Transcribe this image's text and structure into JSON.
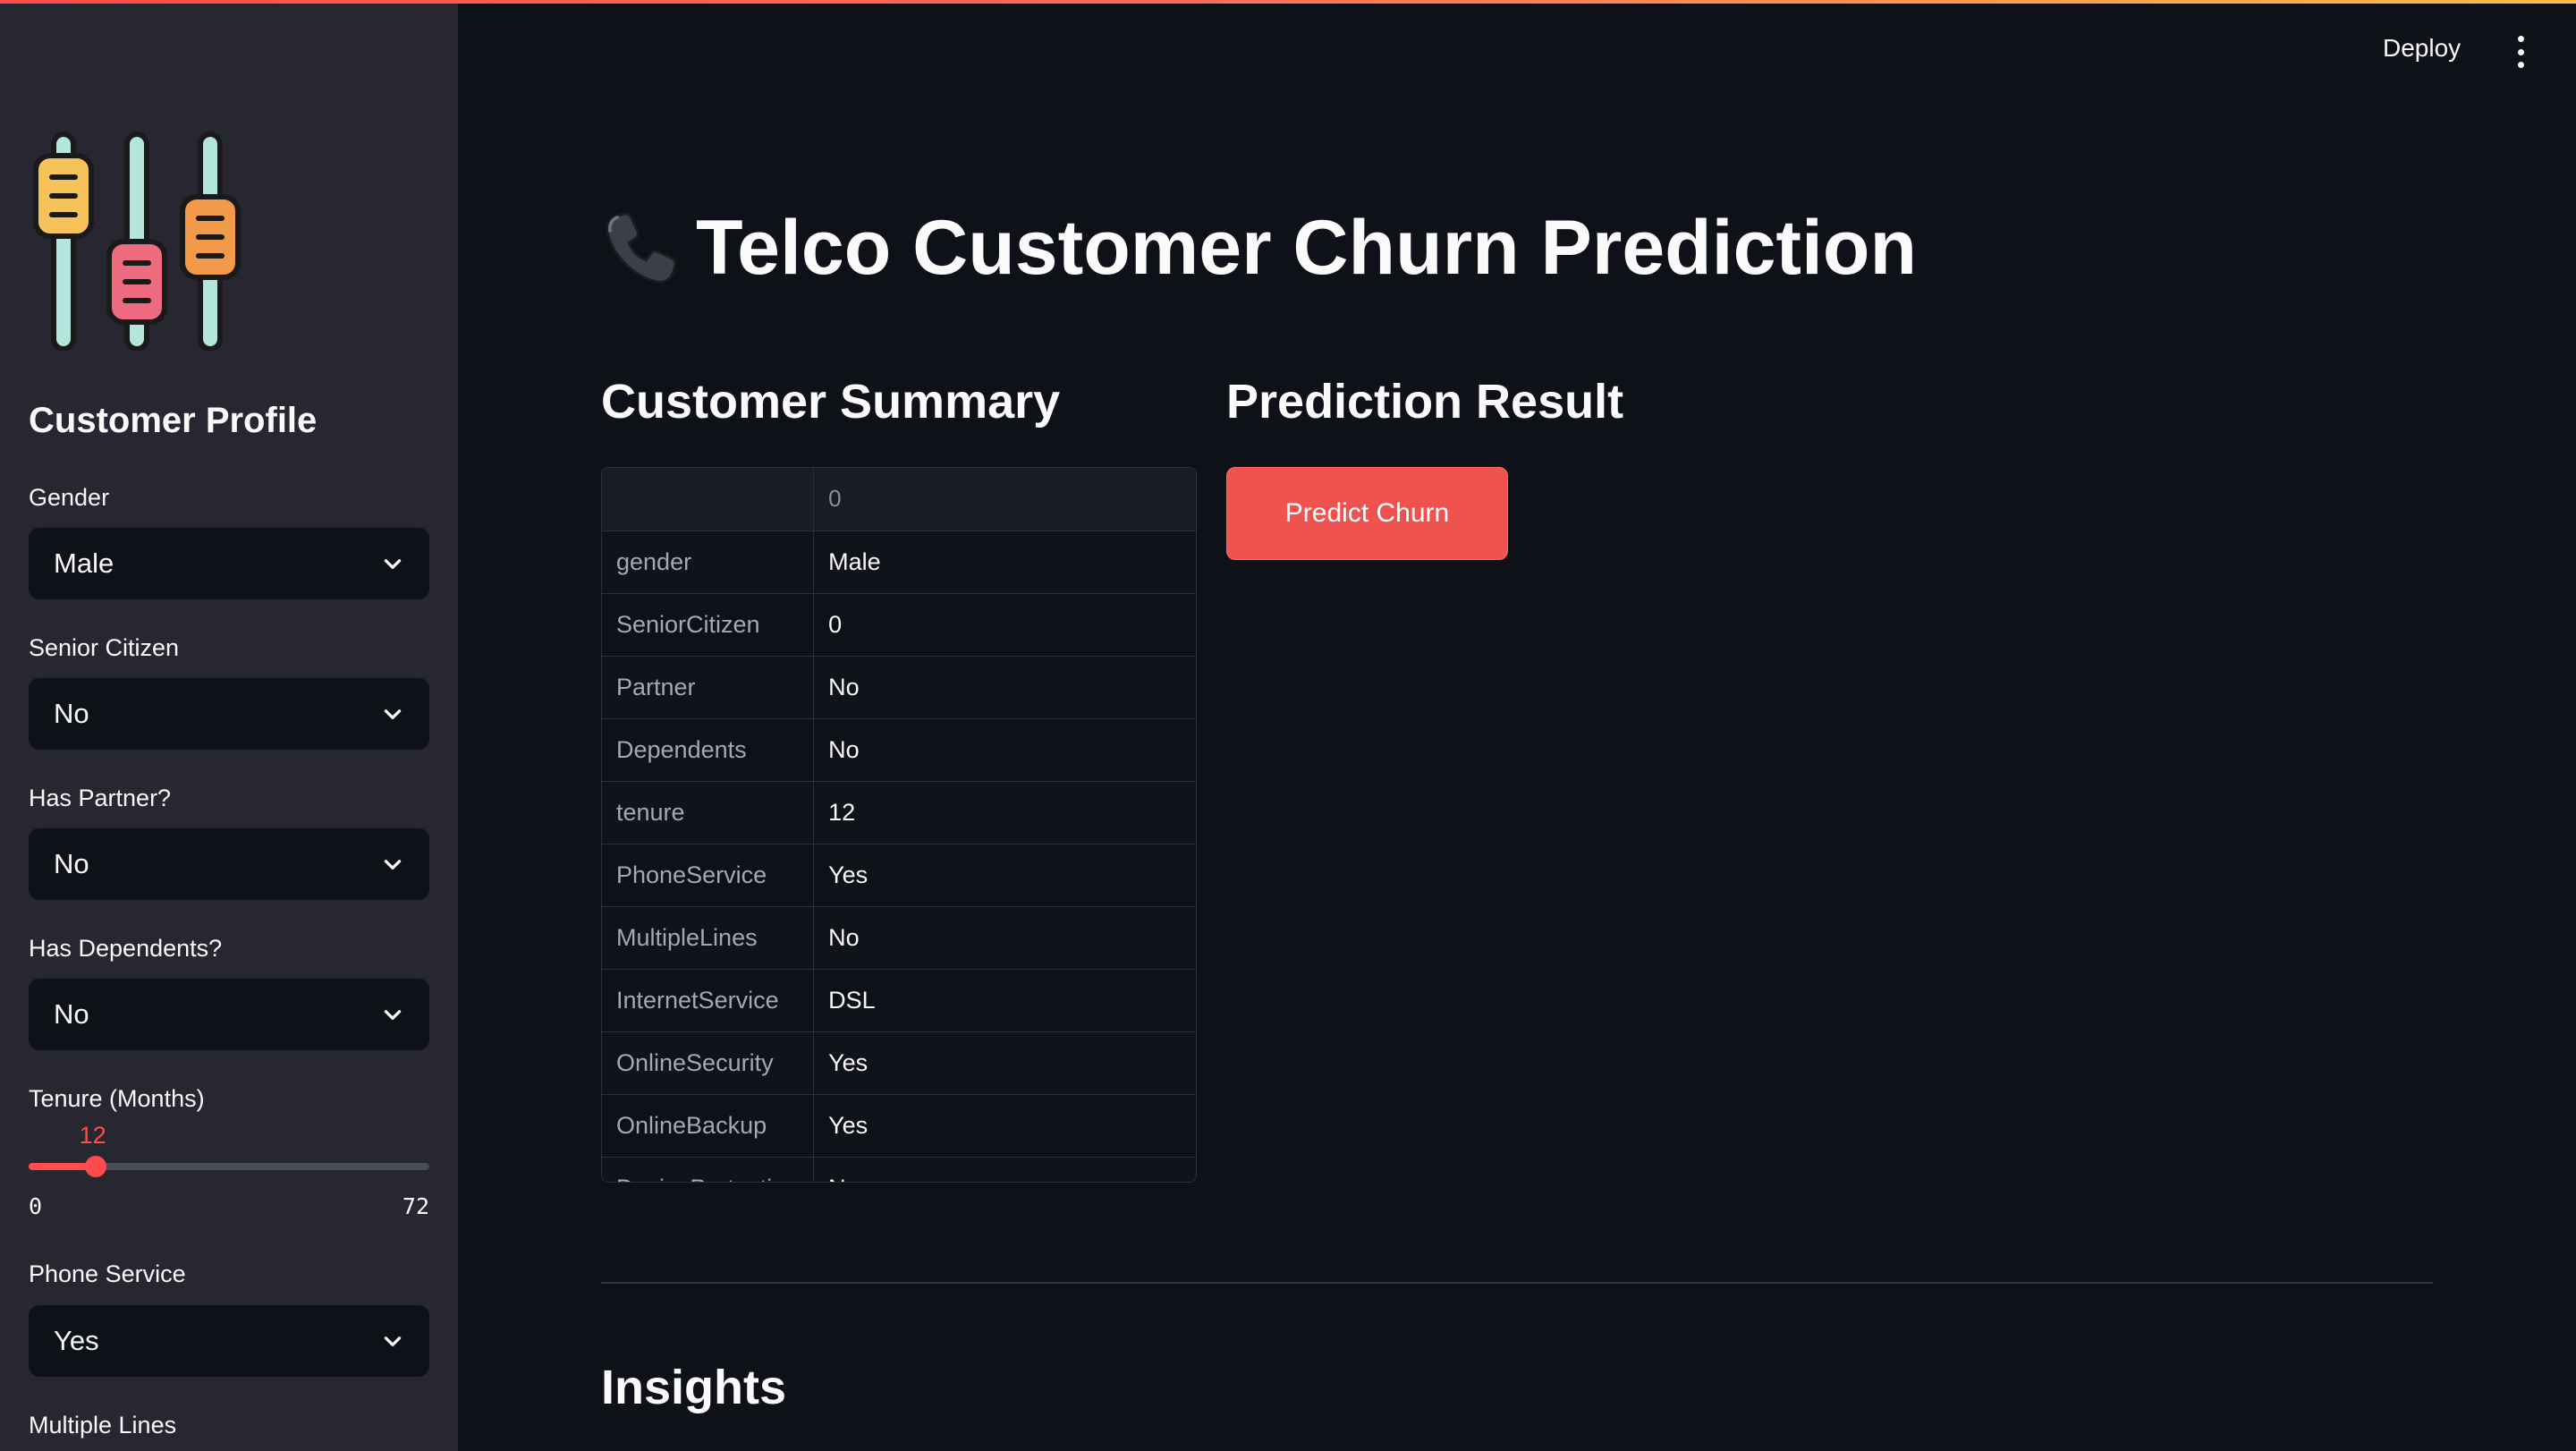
{
  "header": {
    "deploy_label": "Deploy",
    "menu_icon": "kebab-menu-icon"
  },
  "sidebar": {
    "logo_icon": "sliders-icon",
    "title": "Customer Profile",
    "fields": [
      {
        "label": "Gender",
        "value": "Male"
      },
      {
        "label": "Senior Citizen",
        "value": "No"
      },
      {
        "label": "Has Partner?",
        "value": "No"
      },
      {
        "label": "Has Dependents?",
        "value": "No"
      }
    ],
    "tenure": {
      "label": "Tenure (Months)",
      "value": "12",
      "min": "0",
      "max": "72"
    },
    "phone_service": {
      "label": "Phone Service",
      "value": "Yes"
    },
    "multiple_lines": {
      "label": "Multiple Lines"
    }
  },
  "main": {
    "title": "Telco Customer Churn Prediction",
    "title_icon": "telephone-receiver-icon",
    "summary": {
      "heading": "Customer Summary",
      "column_header": "0",
      "rows": [
        {
          "key": "gender",
          "value": "Male"
        },
        {
          "key": "SeniorCitizen",
          "value": "0"
        },
        {
          "key": "Partner",
          "value": "No"
        },
        {
          "key": "Dependents",
          "value": "No"
        },
        {
          "key": "tenure",
          "value": "12"
        },
        {
          "key": "PhoneService",
          "value": "Yes"
        },
        {
          "key": "MultipleLines",
          "value": "No"
        },
        {
          "key": "InternetService",
          "value": "DSL"
        },
        {
          "key": "OnlineSecurity",
          "value": "Yes"
        },
        {
          "key": "OnlineBackup",
          "value": "Yes"
        },
        {
          "key": "DeviceProtection",
          "value": "No"
        }
      ]
    },
    "prediction": {
      "heading": "Prediction Result",
      "button_label": "Predict Churn"
    },
    "insights": {
      "heading": "Insights"
    }
  },
  "colors": {
    "accent": "#ff4b4b",
    "background": "#0e1117",
    "sidebar_bg": "#262730"
  }
}
